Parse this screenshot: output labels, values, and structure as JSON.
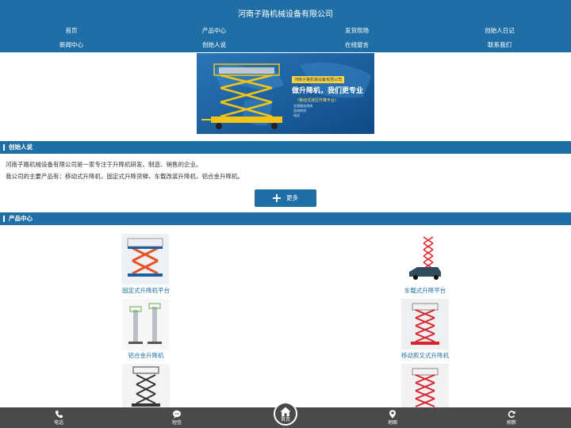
{
  "site": {
    "title": "河南子路机械设备有限公司"
  },
  "nav": [
    {
      "label": "首页"
    },
    {
      "label": "产品中心"
    },
    {
      "label": "发货现场"
    },
    {
      "label": "创始人日记"
    },
    {
      "label": "新闻中心"
    },
    {
      "label": "创始人说"
    },
    {
      "label": "在线留言"
    },
    {
      "label": "联系我们"
    }
  ],
  "banner": {
    "company": "河南子路机械设备有限公司",
    "slogan": "做升降机，我们更专业",
    "product": "（移动式液压升降平台）",
    "lines": [
      "全国服务热线",
      "咨询热线",
      "电话"
    ]
  },
  "founder_section": {
    "title": "创始人说",
    "paragraphs": [
      "河南子路机械设备有限公司是一家专注于升降机研发、制造、销售的企业。",
      "我公司的主要产品有：移动式升降机，固定式升降货梯，车载改装升降机，铝合金升降机。"
    ],
    "more_label": "更多"
  },
  "products_section": {
    "title": "产品中心",
    "items": [
      {
        "name": "固定式升降机平台",
        "icon": "fixed-lift-image"
      },
      {
        "name": "车载式升降平台",
        "icon": "vehicle-lift-image"
      },
      {
        "name": "铝合金升降机",
        "icon": "aluminum-lift-image"
      },
      {
        "name": "移动剪叉式升降机",
        "icon": "mobile-scissor-lift-image"
      },
      {
        "name": "",
        "icon": "scissor-lift-image"
      },
      {
        "name": "",
        "icon": "red-scissor-lift-image"
      }
    ]
  },
  "bottom_nav": [
    {
      "label": "电话",
      "icon": "phone-icon"
    },
    {
      "label": "短信",
      "icon": "message-icon"
    },
    {
      "label": "首页",
      "icon": "home-icon"
    },
    {
      "label": "地图",
      "icon": "map-pin-icon"
    },
    {
      "label": "刷新",
      "icon": "refresh-icon"
    }
  ],
  "colors": {
    "primary": "#1f6fa6",
    "bottom_bar": "#4a4a4a",
    "accent": "#ffd43b",
    "lift_red": "#d9232d"
  }
}
